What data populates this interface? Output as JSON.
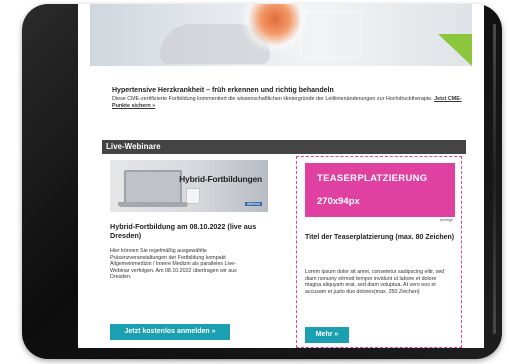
{
  "article": {
    "title": "Hypertensive Herzkrankheit – früh erkennen und richtig behandeln",
    "text": "Diese CME-zertifizierte Fortbildung kommentiert die wissenschaftlichen Hintergründe der Leitlinienänderungen zur Hochdrucktherapie.",
    "link": "Jetzt CME-Punkte sichern »"
  },
  "section": {
    "title": "Live-Webinare"
  },
  "left": {
    "image_label": "Hybrid-Fortbildungen",
    "image_badge": "Webinar",
    "title": "Hybrid-Fortbildung am 08.10.2022 (live aus Dresden)",
    "text": "Hier können Sie regelmäßig ausgewählte Präsenzveranstaltungen der Fortbildung kompakt Allgemeinmedizin / Innere Medizin als paralleles Live-Webinar verfolgen. Am 08.10.2022 übertragen wir aus Dresden.",
    "button": "Jetzt kostenlos anmelden »"
  },
  "right": {
    "teaser_line1": "TEASERPLATZIERUNG",
    "teaser_line2": "270x94px",
    "ad_label": "Anzeige",
    "title": "Titel der Teaserplatzierung (max. 80 Zeichen)",
    "text": "Lorem ipsum dolor sit amet, consetetur sadipscing elitr, sed diam nonumy eirmod tempor invidunt ut labore et dolore magna aliquyam erat, sed diam voluptua. At vero eos et accusam et justo duo dolores(max. 250 Zeichen)",
    "button": "Mehr »"
  },
  "colors": {
    "accent": "#1aa0b2",
    "teaser": "#e040a0",
    "section_bar": "#444444",
    "hero_accent": "#8cc63f"
  }
}
